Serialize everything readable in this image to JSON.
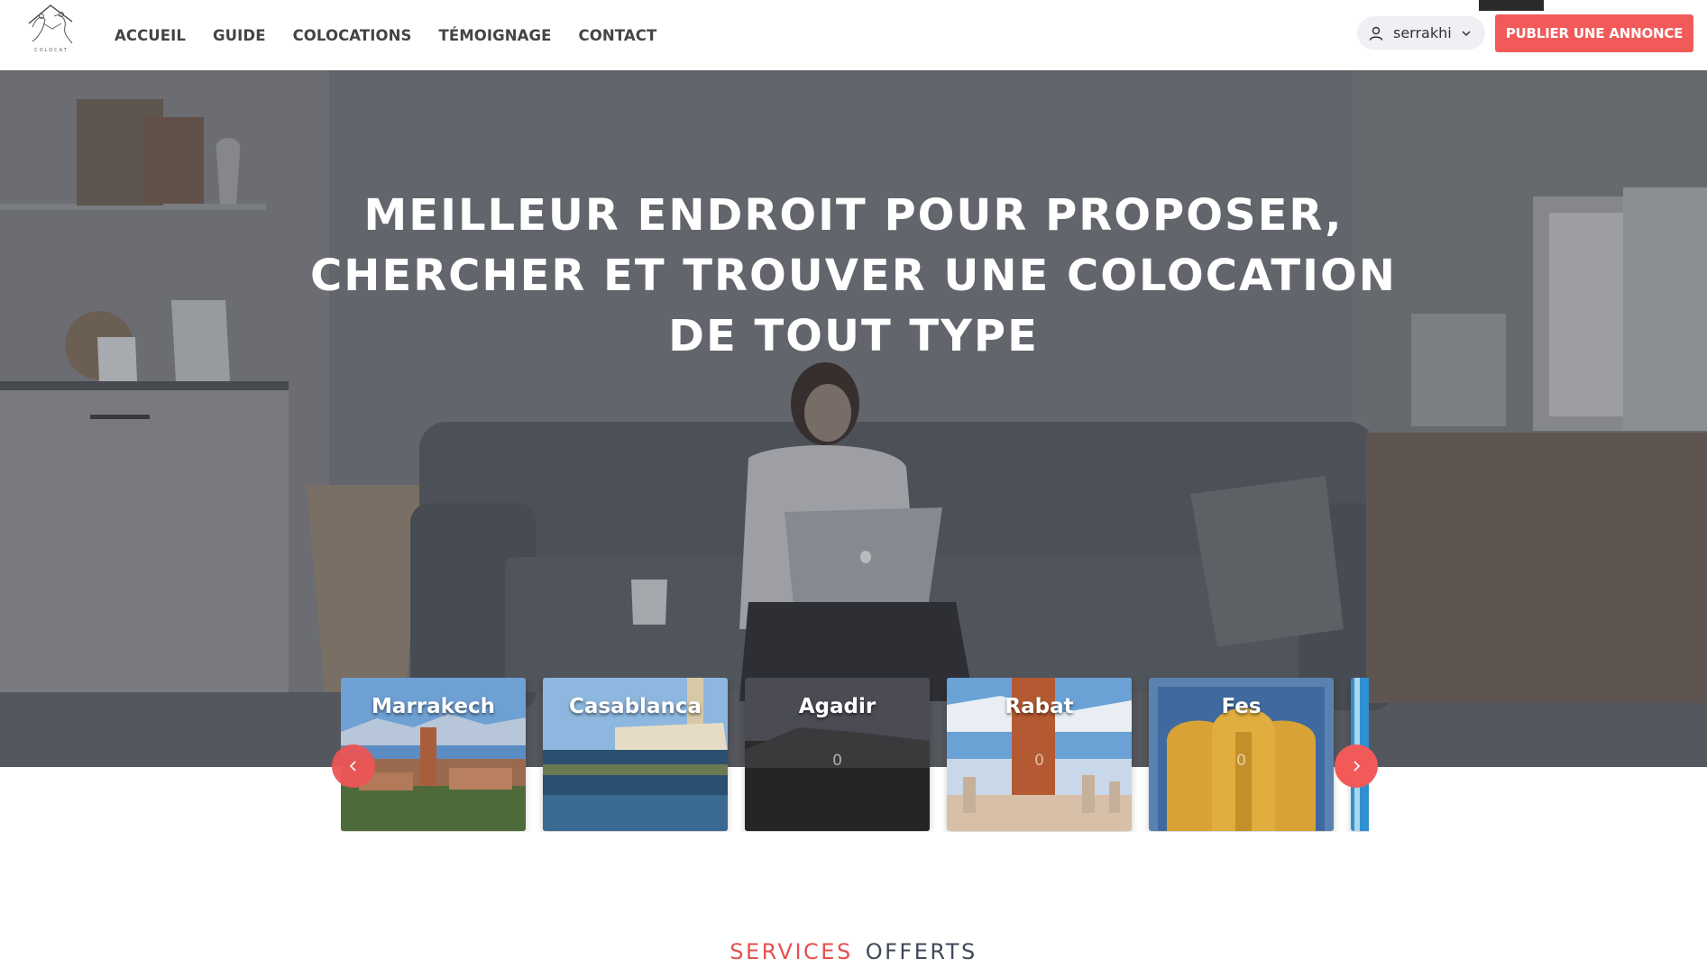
{
  "header": {
    "logo_icon": "colocat-logo-icon",
    "logo_text": "COLOCAT",
    "nav": [
      "ACCUEIL",
      "GUIDE",
      "COLOCATIONS",
      "TÉMOIGNAGE",
      "CONTACT"
    ],
    "user": {
      "icon": "user-icon",
      "name": "serrakhi",
      "chevron": "chevron-down-icon"
    },
    "publish_label": "PUBLIER UNE ANNONCE"
  },
  "hero": {
    "title_lines": [
      "MEILLEUR ENDROIT POUR PROPOSER,",
      "CHERCHER ET TROUVER UNE COLOCATION",
      "DE TOUT TYPE"
    ]
  },
  "cities": [
    {
      "name": "Marrakech",
      "count": ""
    },
    {
      "name": "Casablanca",
      "count": ""
    },
    {
      "name": "Agadir",
      "count": "0"
    },
    {
      "name": "Rabat",
      "count": "0"
    },
    {
      "name": "Fes",
      "count": "0"
    }
  ],
  "services": {
    "word1": "SERVICES",
    "word2": "OFFERTS"
  },
  "colors": {
    "accent": "#f25a5a",
    "services_red": "#e4514f",
    "services_dark": "#3f4a5a"
  }
}
